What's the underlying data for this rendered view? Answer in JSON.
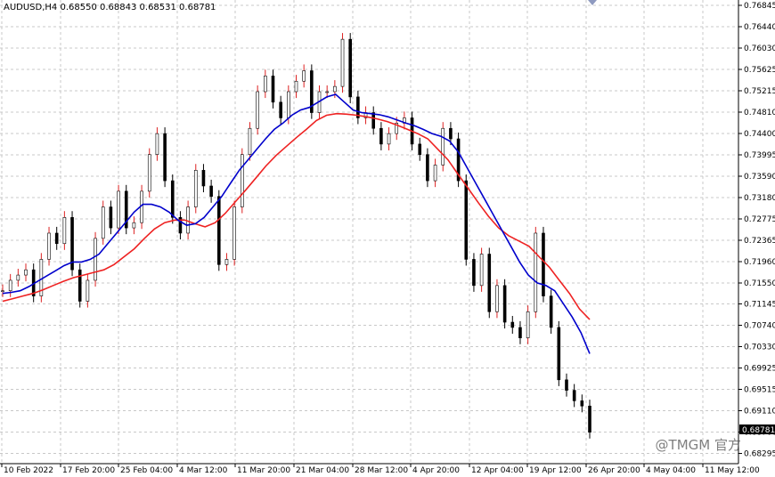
{
  "header": {
    "label": "AUDUSD,H4  0.68550 0.68843 0.68531 0.68781"
  },
  "watermark": "@TMGM 官方",
  "colors": {
    "ma_fast": "#0000cc",
    "ma_slow": "#ee2222",
    "candle": "#000000",
    "bull_wick": "#dd2222",
    "last_price_bg": "#000000"
  },
  "chart_data": {
    "type": "line",
    "title": "AUDUSD,H4",
    "ohlc_label": {
      "open": 0.6855,
      "high": 0.68843,
      "low": 0.68531,
      "close": 0.68781
    },
    "last_price": "0.68781",
    "ylim": [
      0.681,
      0.7695
    ],
    "y_ticks": [
      "0.76845",
      "0.76440",
      "0.76030",
      "0.75625",
      "0.75215",
      "0.74810",
      "0.74400",
      "0.73995",
      "0.73590",
      "0.73180",
      "0.72775",
      "0.72365",
      "0.71960",
      "0.71550",
      "0.71145",
      "0.70740",
      "0.70330",
      "0.69925",
      "0.69515",
      "0.69110",
      "0.68700",
      "0.68295"
    ],
    "x_ticks": [
      "10 Feb 2022",
      "17 Feb 20:00",
      "25 Feb 04:00",
      "4 Mar 12:00",
      "11 Mar 20:00",
      "21 Mar 04:00",
      "28 Mar 12:00",
      "4 Apr 20:00",
      "12 Apr 04:00",
      "19 Apr 12:00",
      "26 Apr 20:00",
      "4 May 04:00",
      "11 May 12:00"
    ],
    "grid": true,
    "series": [
      {
        "color": "#000000",
        "values": [
          0.714,
          0.716,
          0.717,
          0.718,
          0.713,
          0.72,
          0.725,
          0.723,
          0.728,
          0.718,
          0.712,
          0.716,
          0.724,
          0.73,
          0.726,
          0.733,
          0.726,
          0.727,
          0.733,
          0.74,
          0.744,
          0.735,
          0.728,
          0.725,
          0.73,
          0.737,
          0.734,
          0.732,
          0.719,
          0.72,
          0.73,
          0.74,
          0.745,
          0.752,
          0.755,
          0.75,
          0.747,
          0.752,
          0.754,
          0.756,
          0.748,
          0.752,
          0.752,
          0.753,
          0.762,
          0.751,
          0.747,
          0.748,
          0.745,
          0.742,
          0.744,
          0.746,
          0.747,
          0.742,
          0.74,
          0.735,
          0.738,
          0.745,
          0.743,
          0.735,
          0.72,
          0.715,
          0.721,
          0.71,
          0.715,
          0.708,
          0.707,
          0.705,
          0.71,
          0.725,
          0.713,
          0.707,
          0.697,
          0.695,
          0.693,
          0.692,
          0.687
        ]
      },
      {
        "color": "#0000cc",
        "values": [
          0.7135,
          0.7137,
          0.714,
          0.7148,
          0.7158,
          0.7168,
          0.7178,
          0.7188,
          0.7195,
          0.7195,
          0.72,
          0.721,
          0.723,
          0.725,
          0.727,
          0.729,
          0.7305,
          0.7305,
          0.73,
          0.729,
          0.7275,
          0.7265,
          0.7268,
          0.728,
          0.73,
          0.732,
          0.7345,
          0.737,
          0.739,
          0.741,
          0.743,
          0.7448,
          0.746,
          0.7475,
          0.7485,
          0.749,
          0.75,
          0.751,
          0.7515,
          0.75,
          0.7485,
          0.748,
          0.7478,
          0.7476,
          0.7472,
          0.7466,
          0.746,
          0.7455,
          0.7448,
          0.744,
          0.7435,
          0.7426,
          0.7405,
          0.7375,
          0.7345,
          0.7315,
          0.7285,
          0.7255,
          0.7225,
          0.7195,
          0.717,
          0.7155,
          0.715,
          0.714,
          0.7115,
          0.709,
          0.706,
          0.702
        ]
      },
      {
        "color": "#ee2222",
        "values": [
          0.712,
          0.7125,
          0.713,
          0.7135,
          0.7142,
          0.715,
          0.7158,
          0.7165,
          0.717,
          0.7175,
          0.718,
          0.719,
          0.7205,
          0.722,
          0.724,
          0.7258,
          0.727,
          0.7275,
          0.7275,
          0.7268,
          0.7262,
          0.727,
          0.7288,
          0.731,
          0.7332,
          0.7355,
          0.7378,
          0.7398,
          0.7415,
          0.7432,
          0.7448,
          0.7465,
          0.7475,
          0.7478,
          0.7477,
          0.7475,
          0.7472,
          0.7468,
          0.7463,
          0.7456,
          0.7448,
          0.744,
          0.743,
          0.741,
          0.739,
          0.7362,
          0.7335,
          0.7308,
          0.7282,
          0.726,
          0.7245,
          0.7235,
          0.7225,
          0.7205,
          0.7185,
          0.716,
          0.7135,
          0.7105,
          0.7085
        ]
      }
    ]
  }
}
